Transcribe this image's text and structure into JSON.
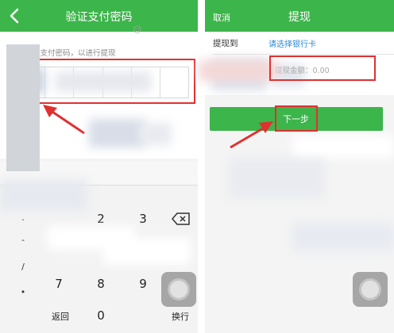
{
  "left_screen": {
    "title": "验证支付密码",
    "prompt": "请输入支付密码，以进行提现",
    "keyboard": {
      "symbols": [
        ".",
        "-",
        "/",
        "•"
      ],
      "keys": [
        "2",
        "3",
        "7",
        "8",
        "9",
        "@",
        "0"
      ],
      "back_label": "返回",
      "newline_label": "换行"
    }
  },
  "right_screen": {
    "cancel_label": "取消",
    "title": "提现",
    "withdraw_to_label": "提现到",
    "bank_select_label": "请选择银行卡",
    "amount_placeholder": "提现金额：0.00",
    "next_button_label": "下一步"
  },
  "colors": {
    "header_green": "#3cb54a",
    "highlight_red": "#e03030",
    "link_blue": "#2a8ad4"
  }
}
